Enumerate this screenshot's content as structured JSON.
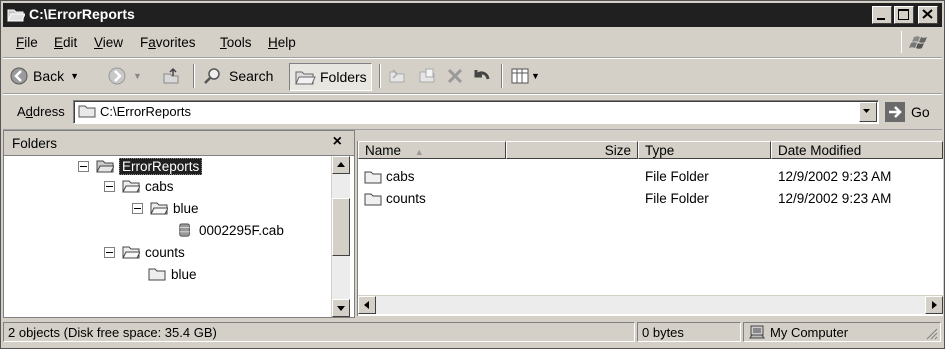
{
  "window": {
    "title": "C:\\ErrorReports"
  },
  "menu": {
    "items": [
      {
        "label": "File",
        "u": "F",
        "rest": "ile"
      },
      {
        "label": "Edit",
        "u": "E",
        "rest": "dit"
      },
      {
        "label": "View",
        "u": "V",
        "rest": "iew"
      },
      {
        "label": "Favorites",
        "pre": "F",
        "u": "a",
        "rest": "vorites"
      },
      {
        "label": "Tools",
        "u": "T",
        "rest": "ools"
      },
      {
        "label": "Help",
        "u": "H",
        "rest": "elp"
      }
    ]
  },
  "toolbar": {
    "back_label": "Back",
    "search_label": "Search",
    "folders_label": "Folders"
  },
  "address": {
    "label_pre": "A",
    "label_u": "d",
    "label_rest": "dress",
    "value": "C:\\ErrorReports",
    "go_label": "Go"
  },
  "folders_pane": {
    "title": "Folders",
    "close_glyph": "×",
    "tree": [
      {
        "label": "ErrorReports",
        "selected": true
      },
      {
        "label": "cabs"
      },
      {
        "label": "blue"
      },
      {
        "label": "0002295F.cab"
      },
      {
        "label": "counts"
      },
      {
        "label": "blue"
      }
    ]
  },
  "list": {
    "columns": [
      "Name",
      "Size",
      "Type",
      "Date Modified"
    ],
    "rows": [
      {
        "name": "cabs",
        "size": "",
        "type": "File Folder",
        "date": "12/9/2002 9:23 AM"
      },
      {
        "name": "counts",
        "size": "",
        "type": "File Folder",
        "date": "12/9/2002 9:23 AM"
      }
    ]
  },
  "status": {
    "objects": "2 objects (Disk free space: 35.4 GB)",
    "size": "0 bytes",
    "location": "My Computer"
  }
}
